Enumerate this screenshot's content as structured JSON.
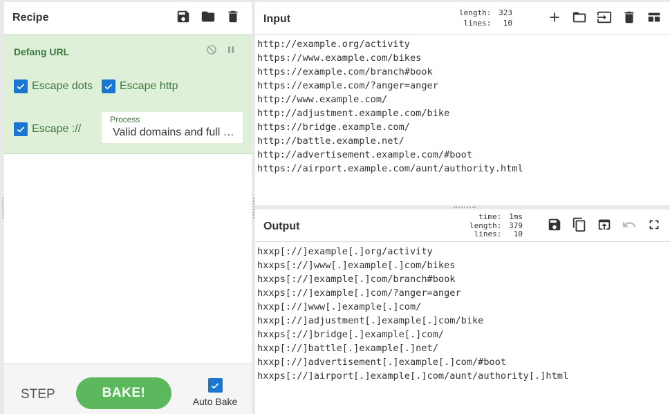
{
  "recipe": {
    "title": "Recipe",
    "icons": [
      "save-icon",
      "folder-icon",
      "delete-icon"
    ],
    "operation": {
      "name": "Defang URL",
      "escape_dots": {
        "label": "Escape dots",
        "checked": true
      },
      "escape_http": {
        "label": "Escape http",
        "checked": true
      },
      "escape_colon": {
        "label": "Escape ://",
        "checked": true
      },
      "process": {
        "label": "Process",
        "value": "Valid domains and full URLs"
      }
    },
    "controls": {
      "step_label": "STEP",
      "bake_label": "BAKE!",
      "autobake_label": "Auto Bake",
      "autobake_checked": true
    }
  },
  "input": {
    "title": "Input",
    "stats": {
      "length_label": "length:",
      "length": "323",
      "lines_label": "lines:",
      "lines": "10"
    },
    "lines": [
      "http://example.org/activity",
      "https://www.example.com/bikes",
      "https://example.com/branch#book",
      "https://example.com/?anger=anger",
      "http://www.example.com/",
      "http://adjustment.example.com/bike",
      "https://bridge.example.com/",
      "http://battle.example.net/",
      "http://advertisement.example.com/#boot",
      "https://airport.example.com/aunt/authority.html"
    ]
  },
  "output": {
    "title": "Output",
    "stats": {
      "time_label": "time:",
      "time": "1ms",
      "length_label": "length:",
      "length": "379",
      "lines_label": "lines:",
      "lines": "10"
    },
    "lines": [
      "hxxp[://]example[.]org/activity",
      "hxxps[://]www[.]example[.]com/bikes",
      "hxxps[://]example[.]com/branch#book",
      "hxxps[://]example[.]com/?anger=anger",
      "hxxp[://]www[.]example[.]com/",
      "hxxp[://]adjustment[.]example[.]com/bike",
      "hxxps[://]bridge[.]example[.]com/",
      "hxxp[://]battle[.]example[.]net/",
      "hxxp[://]advertisement[.]example[.]com/#boot",
      "hxxps[://]airport[.]example[.]com/aunt/authority[.]html"
    ]
  },
  "colors": {
    "operation_bg": "#dff0d8",
    "operation_text": "#3c763d",
    "checkbox": "#1976d2",
    "bake_button": "#5cb85c"
  }
}
